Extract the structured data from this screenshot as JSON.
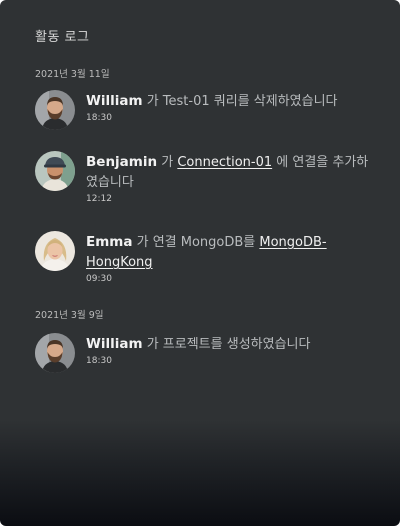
{
  "panel": {
    "title": "활동 로그"
  },
  "groups": [
    {
      "date": "2021년 3월 11일",
      "entries": [
        {
          "user": "William",
          "parts": [
            " 가 Test-01 쿼리를 삭제하였습니다"
          ],
          "time": "18:30",
          "avatar": "avatar-bearded-man"
        },
        {
          "user": "Benjamin",
          "parts": [
            " 가 ",
            "Connection-01",
            " 에 연결을 추가하였습니다"
          ],
          "time": "12:12",
          "avatar": "avatar-man-cap"
        },
        {
          "user": "Emma",
          "parts": [
            " 가 연결 MongoDB를 ",
            "MongoDB-HongKong"
          ],
          "time": "09:30",
          "avatar": "avatar-blonde-woman"
        }
      ]
    },
    {
      "date": "2021년 3월 9일",
      "entries": [
        {
          "user": "William",
          "parts": [
            " 가 프로젝트를 생성하였습니다"
          ],
          "time": "18:30",
          "avatar": "avatar-bearded-man"
        }
      ]
    }
  ]
}
